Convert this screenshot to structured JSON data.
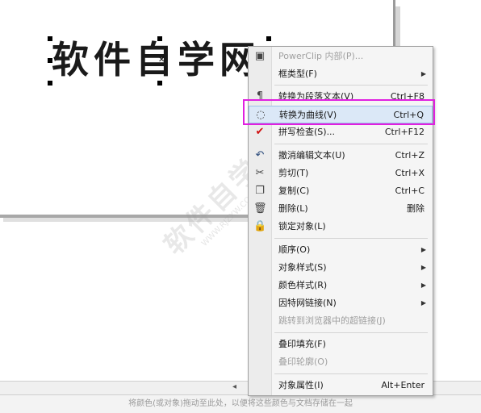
{
  "canvas": {
    "art_text": "软件自学网"
  },
  "watermark": {
    "text": "软件自学网",
    "sub": "WWW.RJZXW.COM"
  },
  "colors": {
    "highlight_box": "#e020e0",
    "menu_hover_bg": "#dbe8f7"
  },
  "status": {
    "color_bar_hint": "将颜色(或对象)拖动至此处，以便将这些颜色与文档存储在一起"
  },
  "menu": {
    "items": [
      {
        "label": "PowerClip 内部(P)...",
        "shortcut": "",
        "icon": "powerclip-icon",
        "disabled": true
      },
      {
        "label": "框类型(F)",
        "shortcut": "",
        "submenu": true
      },
      {
        "label": "转换为段落文本(V)",
        "shortcut": "Ctrl+F8",
        "icon": "paragraph-text-icon"
      },
      {
        "label": "转换为曲线(V)",
        "shortcut": "Ctrl+Q",
        "icon": "convert-curve-icon",
        "highlighted": true
      },
      {
        "label": "拼写检查(S)...",
        "shortcut": "Ctrl+F12",
        "icon": "spell-check-icon"
      },
      {
        "label": "撤消编辑文本(U)",
        "shortcut": "Ctrl+Z",
        "icon": "undo-icon"
      },
      {
        "label": "剪切(T)",
        "shortcut": "Ctrl+X",
        "icon": "scissors-icon"
      },
      {
        "label": "复制(C)",
        "shortcut": "Ctrl+C",
        "icon": "copy-icon"
      },
      {
        "label": "删除(L)",
        "shortcut": "删除",
        "icon": "trash-icon"
      },
      {
        "label": "锁定对象(L)",
        "shortcut": "",
        "icon": "lock-icon"
      },
      {
        "label": "顺序(O)",
        "shortcut": "",
        "submenu": true
      },
      {
        "label": "对象样式(S)",
        "shortcut": "",
        "submenu": true
      },
      {
        "label": "颜色样式(R)",
        "shortcut": "",
        "submenu": true
      },
      {
        "label": "因特网链接(N)",
        "shortcut": "",
        "submenu": true
      },
      {
        "label": "跳转到浏览器中的超链接(J)",
        "shortcut": "",
        "disabled": true
      },
      {
        "label": "叠印填充(F)",
        "shortcut": ""
      },
      {
        "label": "叠印轮廓(O)",
        "shortcut": "",
        "disabled": true
      },
      {
        "label": "对象属性(I)",
        "shortcut": "Alt+Enter"
      }
    ]
  }
}
